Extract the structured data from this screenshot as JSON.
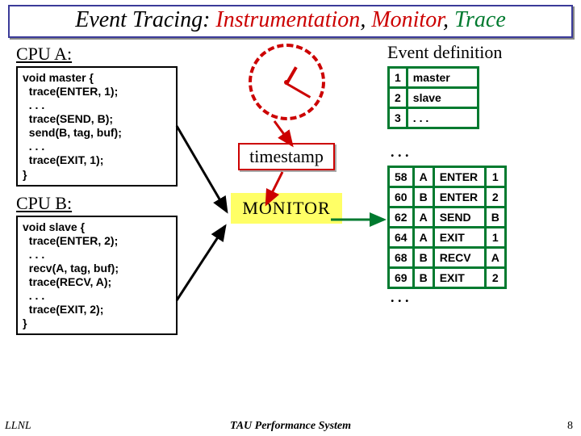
{
  "title": {
    "t1": "Event Tracing:",
    "t2": "Instrumentation",
    "sep": ", ",
    "t3a": "Monitor",
    "t3b": "Trace"
  },
  "left": {
    "cpuA_label": "CPU A:",
    "cpuA_code": "void master {\n  trace(ENTER, 1);\n  . . .\n  trace(SEND, B);\n  send(B, tag, buf);\n  . . .\n  trace(EXIT, 1);\n}",
    "cpuB_label": "CPU B:",
    "cpuB_code": "void slave {\n  trace(ENTER, 2);\n  . . .\n  recv(A, tag, buf);\n  trace(RECV, A);\n  . . .\n  trace(EXIT, 2);\n}"
  },
  "center": {
    "timestamp_label": "timestamp",
    "monitor_label": "MONITOR"
  },
  "right": {
    "evdef_title": "Event definition",
    "defs": [
      {
        "id": "1",
        "name": "master"
      },
      {
        "id": "2",
        "name": "slave"
      },
      {
        "id": "3",
        "name": ". . ."
      }
    ],
    "trace_ellipsis_top": ". . .",
    "log": [
      {
        "time": "58",
        "cpu": "A",
        "event": "ENTER",
        "arg": "1"
      },
      {
        "time": "60",
        "cpu": "B",
        "event": "ENTER",
        "arg": "2"
      },
      {
        "time": "62",
        "cpu": "A",
        "event": "SEND",
        "arg": "B"
      },
      {
        "time": "64",
        "cpu": "A",
        "event": "EXIT",
        "arg": "1"
      },
      {
        "time": "68",
        "cpu": "B",
        "event": "RECV",
        "arg": "A"
      },
      {
        "time": "69",
        "cpu": "B",
        "event": "EXIT",
        "arg": "2"
      }
    ],
    "trace_ellipsis_bottom": ". . ."
  },
  "footer": {
    "left": "LLNL",
    "center": "TAU Performance System",
    "right": "8"
  }
}
